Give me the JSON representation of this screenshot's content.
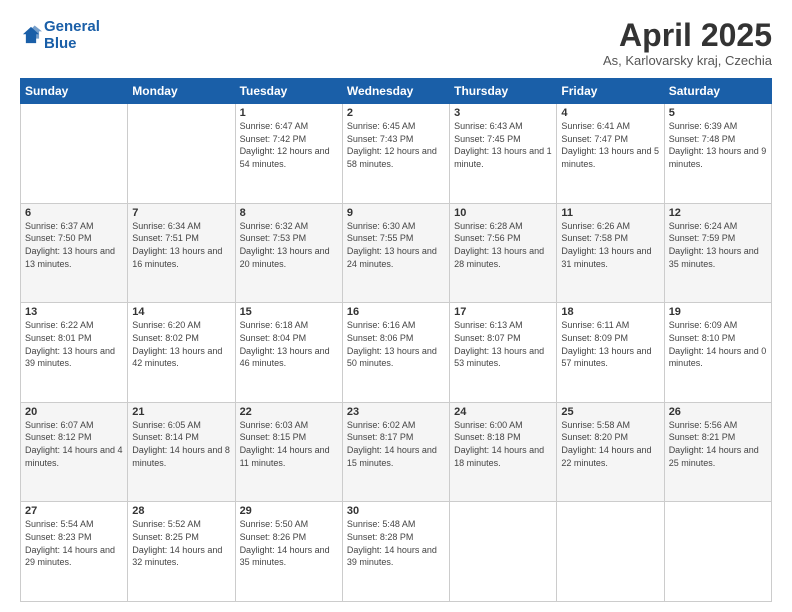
{
  "header": {
    "logo_line1": "General",
    "logo_line2": "Blue",
    "month": "April 2025",
    "location": "As, Karlovarsky kraj, Czechia"
  },
  "weekdays": [
    "Sunday",
    "Monday",
    "Tuesday",
    "Wednesday",
    "Thursday",
    "Friday",
    "Saturday"
  ],
  "weeks": [
    [
      {
        "day": "",
        "info": ""
      },
      {
        "day": "",
        "info": ""
      },
      {
        "day": "1",
        "info": "Sunrise: 6:47 AM\nSunset: 7:42 PM\nDaylight: 12 hours\nand 54 minutes."
      },
      {
        "day": "2",
        "info": "Sunrise: 6:45 AM\nSunset: 7:43 PM\nDaylight: 12 hours\nand 58 minutes."
      },
      {
        "day": "3",
        "info": "Sunrise: 6:43 AM\nSunset: 7:45 PM\nDaylight: 13 hours\nand 1 minute."
      },
      {
        "day": "4",
        "info": "Sunrise: 6:41 AM\nSunset: 7:47 PM\nDaylight: 13 hours\nand 5 minutes."
      },
      {
        "day": "5",
        "info": "Sunrise: 6:39 AM\nSunset: 7:48 PM\nDaylight: 13 hours\nand 9 minutes."
      }
    ],
    [
      {
        "day": "6",
        "info": "Sunrise: 6:37 AM\nSunset: 7:50 PM\nDaylight: 13 hours\nand 13 minutes."
      },
      {
        "day": "7",
        "info": "Sunrise: 6:34 AM\nSunset: 7:51 PM\nDaylight: 13 hours\nand 16 minutes."
      },
      {
        "day": "8",
        "info": "Sunrise: 6:32 AM\nSunset: 7:53 PM\nDaylight: 13 hours\nand 20 minutes."
      },
      {
        "day": "9",
        "info": "Sunrise: 6:30 AM\nSunset: 7:55 PM\nDaylight: 13 hours\nand 24 minutes."
      },
      {
        "day": "10",
        "info": "Sunrise: 6:28 AM\nSunset: 7:56 PM\nDaylight: 13 hours\nand 28 minutes."
      },
      {
        "day": "11",
        "info": "Sunrise: 6:26 AM\nSunset: 7:58 PM\nDaylight: 13 hours\nand 31 minutes."
      },
      {
        "day": "12",
        "info": "Sunrise: 6:24 AM\nSunset: 7:59 PM\nDaylight: 13 hours\nand 35 minutes."
      }
    ],
    [
      {
        "day": "13",
        "info": "Sunrise: 6:22 AM\nSunset: 8:01 PM\nDaylight: 13 hours\nand 39 minutes."
      },
      {
        "day": "14",
        "info": "Sunrise: 6:20 AM\nSunset: 8:02 PM\nDaylight: 13 hours\nand 42 minutes."
      },
      {
        "day": "15",
        "info": "Sunrise: 6:18 AM\nSunset: 8:04 PM\nDaylight: 13 hours\nand 46 minutes."
      },
      {
        "day": "16",
        "info": "Sunrise: 6:16 AM\nSunset: 8:06 PM\nDaylight: 13 hours\nand 50 minutes."
      },
      {
        "day": "17",
        "info": "Sunrise: 6:13 AM\nSunset: 8:07 PM\nDaylight: 13 hours\nand 53 minutes."
      },
      {
        "day": "18",
        "info": "Sunrise: 6:11 AM\nSunset: 8:09 PM\nDaylight: 13 hours\nand 57 minutes."
      },
      {
        "day": "19",
        "info": "Sunrise: 6:09 AM\nSunset: 8:10 PM\nDaylight: 14 hours\nand 0 minutes."
      }
    ],
    [
      {
        "day": "20",
        "info": "Sunrise: 6:07 AM\nSunset: 8:12 PM\nDaylight: 14 hours\nand 4 minutes."
      },
      {
        "day": "21",
        "info": "Sunrise: 6:05 AM\nSunset: 8:14 PM\nDaylight: 14 hours\nand 8 minutes."
      },
      {
        "day": "22",
        "info": "Sunrise: 6:03 AM\nSunset: 8:15 PM\nDaylight: 14 hours\nand 11 minutes."
      },
      {
        "day": "23",
        "info": "Sunrise: 6:02 AM\nSunset: 8:17 PM\nDaylight: 14 hours\nand 15 minutes."
      },
      {
        "day": "24",
        "info": "Sunrise: 6:00 AM\nSunset: 8:18 PM\nDaylight: 14 hours\nand 18 minutes."
      },
      {
        "day": "25",
        "info": "Sunrise: 5:58 AM\nSunset: 8:20 PM\nDaylight: 14 hours\nand 22 minutes."
      },
      {
        "day": "26",
        "info": "Sunrise: 5:56 AM\nSunset: 8:21 PM\nDaylight: 14 hours\nand 25 minutes."
      }
    ],
    [
      {
        "day": "27",
        "info": "Sunrise: 5:54 AM\nSunset: 8:23 PM\nDaylight: 14 hours\nand 29 minutes."
      },
      {
        "day": "28",
        "info": "Sunrise: 5:52 AM\nSunset: 8:25 PM\nDaylight: 14 hours\nand 32 minutes."
      },
      {
        "day": "29",
        "info": "Sunrise: 5:50 AM\nSunset: 8:26 PM\nDaylight: 14 hours\nand 35 minutes."
      },
      {
        "day": "30",
        "info": "Sunrise: 5:48 AM\nSunset: 8:28 PM\nDaylight: 14 hours\nand 39 minutes."
      },
      {
        "day": "",
        "info": ""
      },
      {
        "day": "",
        "info": ""
      },
      {
        "day": "",
        "info": ""
      }
    ]
  ]
}
